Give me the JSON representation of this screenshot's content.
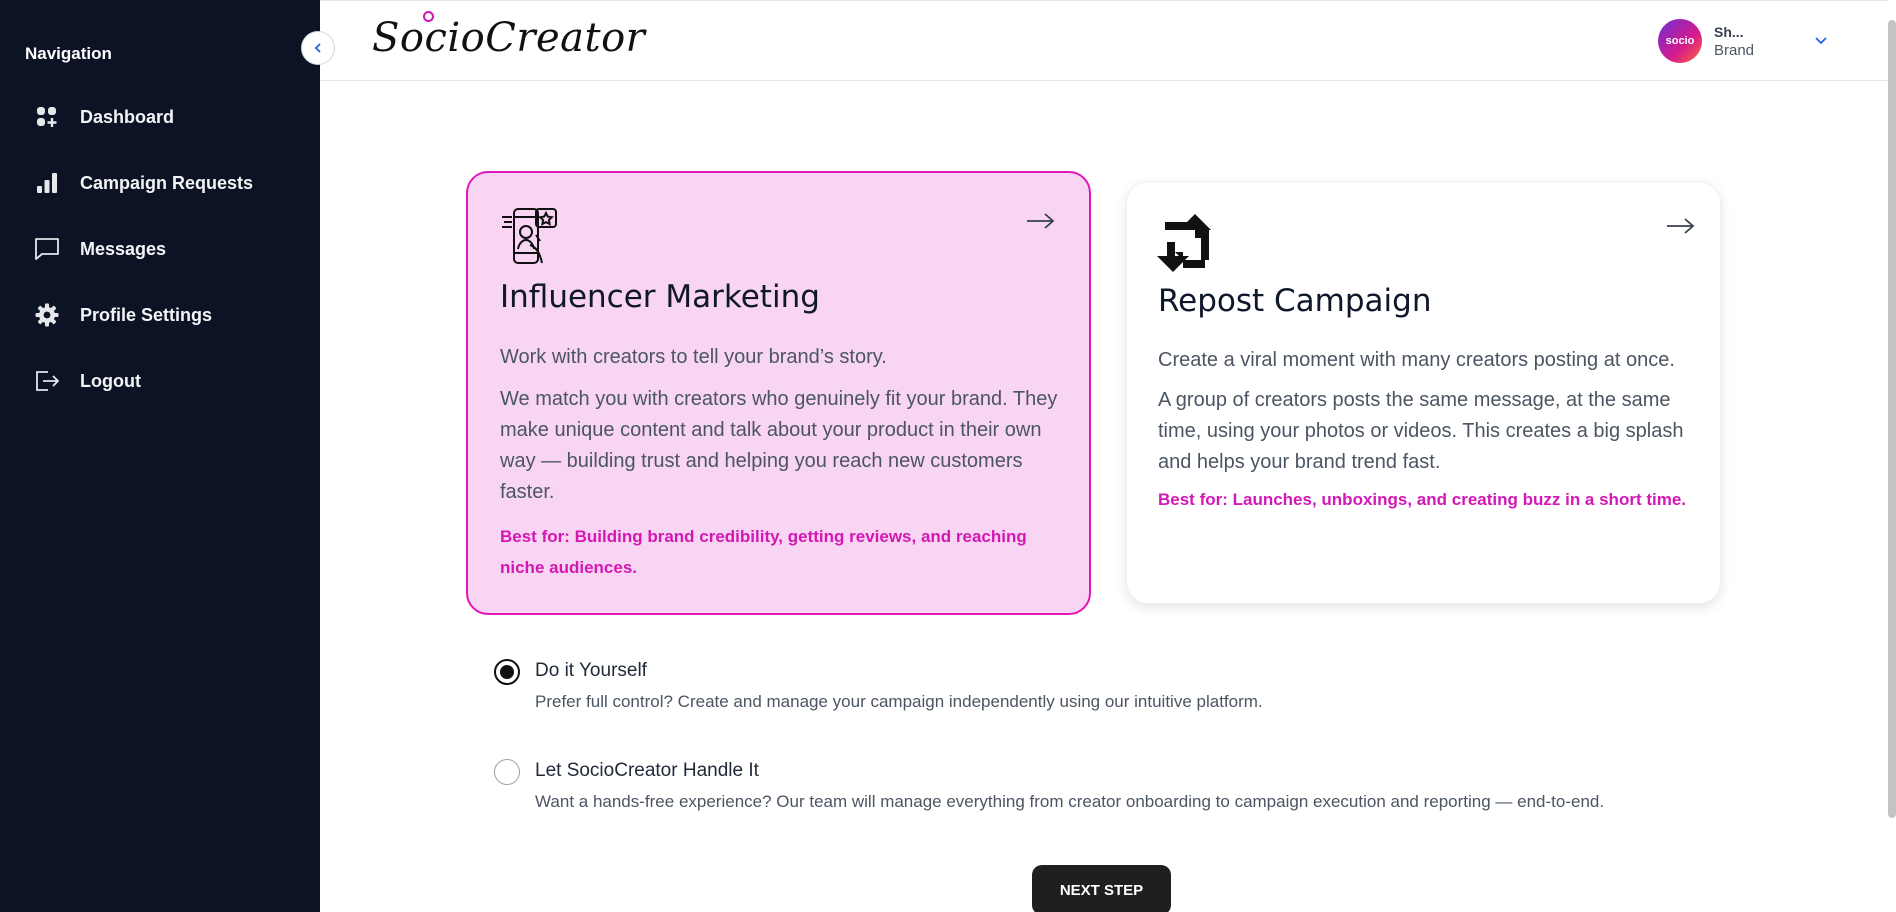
{
  "sidebar": {
    "title": "Navigation",
    "items": [
      {
        "label": "Dashboard",
        "icon": "dashboard-icon"
      },
      {
        "label": "Campaign Requests",
        "icon": "bar-chart-icon"
      },
      {
        "label": "Messages",
        "icon": "message-icon"
      },
      {
        "label": "Profile Settings",
        "icon": "gear-icon"
      },
      {
        "label": "Logout",
        "icon": "logout-icon"
      }
    ]
  },
  "header": {
    "logo_text": "SocioCreator",
    "user": {
      "avatar_text": "socio",
      "name": "Sh...",
      "role": "Brand"
    }
  },
  "cards": [
    {
      "title": "Influencer Marketing",
      "subtitle": "Work with creators to tell your brand’s story.",
      "body": "We match you with creators who genuinely fit your brand. They make unique content and talk about your product in their own way — building trust and helping you reach new customers faster.",
      "best_for": "Best for: Building brand credibility, getting reviews, and reaching niche audiences.",
      "selected": true,
      "icon": "influencer-phone-icon"
    },
    {
      "title": "Repost Campaign",
      "subtitle": "Create a viral moment with many creators posting at once.",
      "body": "A group of creators posts the same message, at the same time, using your photos or videos. This creates a big splash and helps your brand trend fast.",
      "best_for": "Best for: Launches, unboxings, and creating buzz in a short time.",
      "selected": false,
      "icon": "repost-icon"
    }
  ],
  "options": [
    {
      "title": "Do it Yourself",
      "description": "Prefer full control? Create and manage your campaign independently using our intuitive platform.",
      "checked": true
    },
    {
      "title": "Let SocioCreator Handle It",
      "description": "Want a hands-free experience? Our team will manage everything from creator onboarding to campaign execution and reporting — end-to-end.",
      "checked": false
    }
  ],
  "next_button": "NEXT STEP",
  "colors": {
    "sidebar_bg": "#0b1324",
    "accent": "#d318b5",
    "card_active_bg": "#f8d5f2"
  }
}
